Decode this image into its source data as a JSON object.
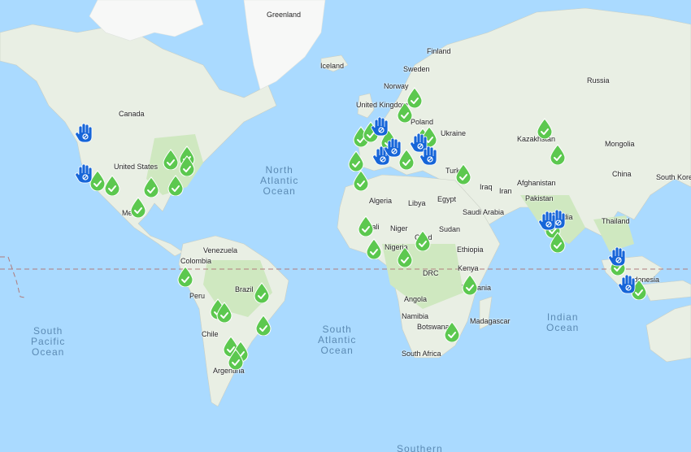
{
  "map": {
    "land_color": "#e9efe4",
    "water_color": "#aadaff",
    "ocean_labels": [
      {
        "key": "north-atlantic",
        "lines": [
          "North",
          "Atlantic",
          "Ocean"
        ]
      },
      {
        "key": "south-pacific",
        "lines": [
          "South",
          "Pacific",
          "Ocean"
        ]
      },
      {
        "key": "south-atlantic",
        "lines": [
          "South",
          "Atlantic",
          "Ocean"
        ]
      },
      {
        "key": "indian",
        "lines": [
          "Indian",
          "Ocean"
        ]
      },
      {
        "key": "southern",
        "lines": [
          "Southern"
        ]
      }
    ],
    "place_labels": [
      "Greenland",
      "Finland",
      "Sweden",
      "Norway",
      "Iceland",
      "Russia",
      "Canada",
      "United Kingdom",
      "Poland",
      "Ukraine",
      "Kazakhstan",
      "Mongolia",
      "United States",
      "Turkey",
      "Iraq",
      "Iran",
      "Afghanistan",
      "China",
      "South Kore",
      "Algeria",
      "Libya",
      "Egypt",
      "Pakistan",
      "Saudi Arabia",
      "Mexico",
      "Mali",
      "Niger",
      "Chad",
      "Sudan",
      "India",
      "Thailand",
      "Venezuela",
      "Nigeria",
      "Ethiopia",
      "Colombia",
      "Kenya",
      "DRC",
      "Peru",
      "Brazil",
      "Tanzania",
      "Indonesia",
      "Angola",
      "Namibia",
      "Madagascar",
      "Botswana",
      "Chile",
      "South Africa",
      "Argentina"
    ]
  },
  "legend": {
    "green_marker": {
      "icon": "water-drop-check-icon",
      "color": "#5cc84f"
    },
    "blue_marker": {
      "icon": "raised-hand-icon",
      "color": "#1665d8"
    }
  }
}
